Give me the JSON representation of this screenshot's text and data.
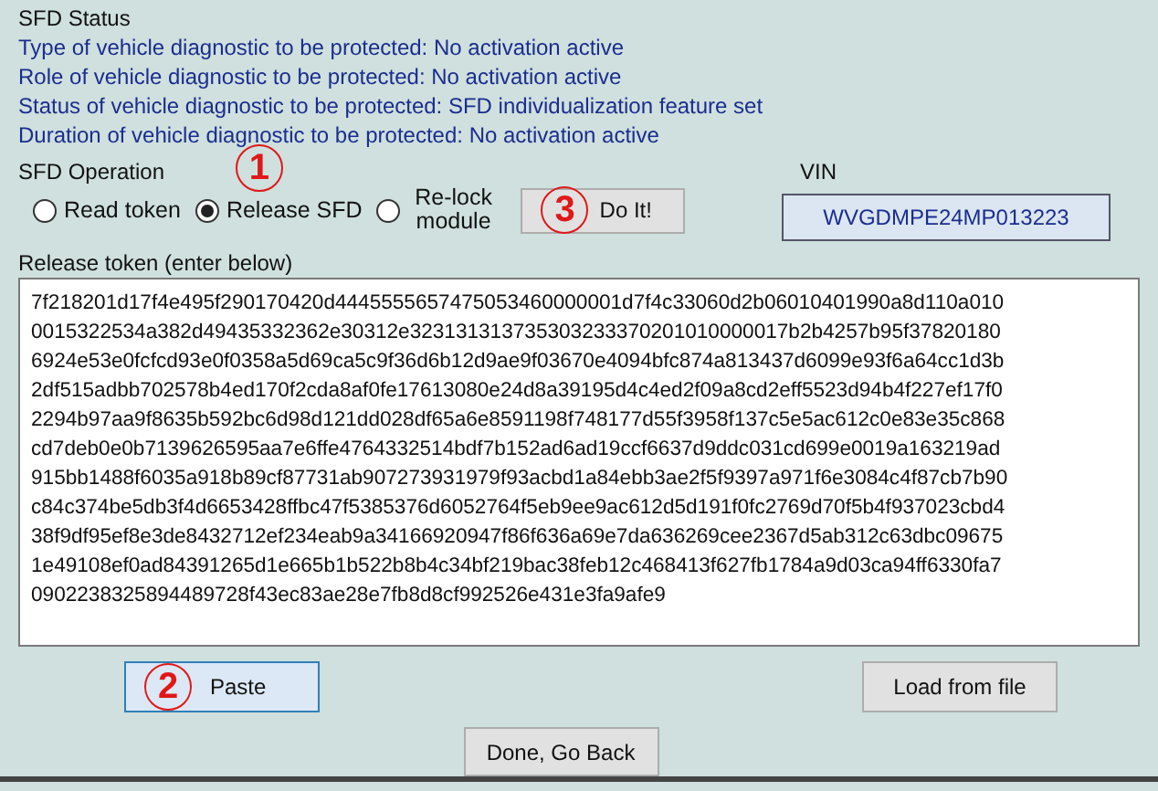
{
  "status": {
    "title": "SFD Status",
    "lines": [
      "Type of vehicle diagnostic to be protected: No activation active",
      "Role of vehicle diagnostic to be protected: No activation active",
      "Status of vehicle diagnostic to be protected: SFD individualization feature set",
      "Duration of vehicle diagnostic to be protected: No activation active"
    ]
  },
  "operation": {
    "title": "SFD Operation",
    "options": [
      {
        "label": "Read token",
        "selected": false
      },
      {
        "label": "Release SFD",
        "selected": true,
        "step": "1"
      },
      {
        "label": "Re-lock module",
        "selected": false
      }
    ],
    "do_button": {
      "label": "Do It!",
      "step": "3"
    }
  },
  "vin": {
    "label": "VIN",
    "value": "WVGDMPE24MP013223"
  },
  "token": {
    "label": "Release token (enter below)",
    "lines": [
      "7f218201d17f4e495f290170420d4445555657475053460000001d7f4c33060d2b06010401990a8d110a010",
      "0015322534a382d49435332362e30312e323131313735303233370201010000017b2b4257b95f37820180",
      "6924e53e0fcfcd93e0f0358a5d69ca5c9f36d6b12d9ae9f03670e4094bfc874a813437d6099e93f6a64cc1d3b",
      "2df515adbb702578b4ed170f2cda8af0fe17613080e24d8a39195d4c4ed2f09a8cd2eff5523d94b4f227ef17f0",
      "2294b97aa9f8635b592bc6d98d121dd028df65a6e8591198f748177d55f3958f137c5e5ac612c0e83e35c868",
      "cd7deb0e0b7139626595aa7e6ffe4764332514bdf7b152ad6ad19ccf6637d9ddc031cd699e0019a163219ad",
      "915bb1488f6035a918b89cf87731ab907273931979f93acbd1a84ebb3ae2f5f9397a971f6e3084c4f87cb7b90",
      "c84c374be5db3f4d6653428ffbc47f5385376d6052764f5eb9ee9ac612d5d191f0fc2769d70f5b4f937023cbd4",
      "38f9df95ef8e3de8432712ef234eab9a34166920947f86f636a69e7da636269cee2367d5ab312c63dbc09675",
      "1e49108ef0ad84391265d1e665b1b522b8b4c34bf219bac38feb12c468413f627fb1784a9d03ca94ff6330fa7",
      "0902238325894489728f43ec83ae28e7fb8d8cf992526e431e3fa9afe9"
    ]
  },
  "paste_button": {
    "label": "Paste",
    "step": "2",
    "selected": true
  },
  "load_button": {
    "label": "Load from file"
  },
  "done_button": {
    "label": "Done, Go Back"
  }
}
